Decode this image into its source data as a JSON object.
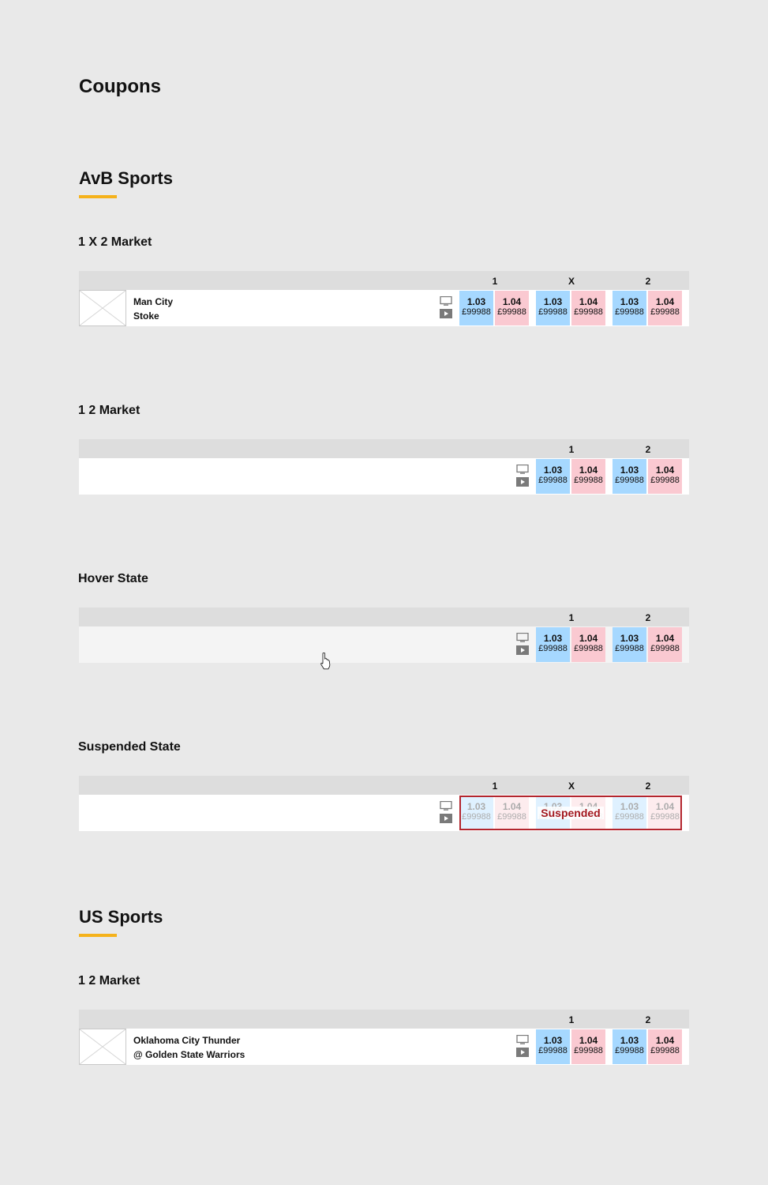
{
  "page": {
    "title": "Coupons"
  },
  "colors": {
    "accent": "#f5b21b",
    "back": "#a6d8ff",
    "lay": "#fac9d1",
    "suspended": "#b3262e"
  },
  "icons": {
    "tv": "tv-icon",
    "play": "play-icon",
    "thumbnail": "image-placeholder-icon",
    "cursor": "hand-cursor-icon"
  },
  "avb": {
    "title": "AvB Sports",
    "market_1x2": {
      "title": "1 X 2 Market",
      "columns": [
        "1",
        "X",
        "2"
      ],
      "teams": [
        "Man City",
        "Stoke"
      ],
      "odds": [
        {
          "back": "1.03",
          "back_amount": "£99988",
          "lay": "1.04",
          "lay_amount": "£99988"
        },
        {
          "back": "1.03",
          "back_amount": "£99988",
          "lay": "1.04",
          "lay_amount": "£99988"
        },
        {
          "back": "1.03",
          "back_amount": "£99988",
          "lay": "1.04",
          "lay_amount": "£99988"
        }
      ]
    },
    "market_12": {
      "title": "1 2 Market",
      "columns": [
        "1",
        "2"
      ],
      "odds": [
        {
          "back": "1.03",
          "back_amount": "£99988",
          "lay": "1.04",
          "lay_amount": "£99988"
        },
        {
          "back": "1.03",
          "back_amount": "£99988",
          "lay": "1.04",
          "lay_amount": "£99988"
        }
      ]
    },
    "hover": {
      "title": "Hover State",
      "columns": [
        "1",
        "2"
      ],
      "odds": [
        {
          "back": "1.03",
          "back_amount": "£99988",
          "lay": "1.04",
          "lay_amount": "£99988"
        },
        {
          "back": "1.03",
          "back_amount": "£99988",
          "lay": "1.04",
          "lay_amount": "£99988"
        }
      ]
    },
    "suspended": {
      "title": "Suspended State",
      "columns": [
        "1",
        "X",
        "2"
      ],
      "label": "Suspended",
      "odds": [
        {
          "back": "1.03",
          "back_amount": "£99988",
          "lay": "1.04",
          "lay_amount": "£99988"
        },
        {
          "back": "1.03",
          "back_amount": "£99988",
          "lay": "1.04",
          "lay_amount": "£99988"
        },
        {
          "back": "1.03",
          "back_amount": "£99988",
          "lay": "1.04",
          "lay_amount": "£99988"
        }
      ]
    }
  },
  "us": {
    "title": "US Sports",
    "market_12": {
      "title": "1 2 Market",
      "columns": [
        "1",
        "2"
      ],
      "teams": [
        "Oklahoma City Thunder",
        "@ Golden State Warriors"
      ],
      "odds": [
        {
          "back": "1.03",
          "back_amount": "£99988",
          "lay": "1.04",
          "lay_amount": "£99988"
        },
        {
          "back": "1.03",
          "back_amount": "£99988",
          "lay": "1.04",
          "lay_amount": "£99988"
        }
      ]
    }
  }
}
